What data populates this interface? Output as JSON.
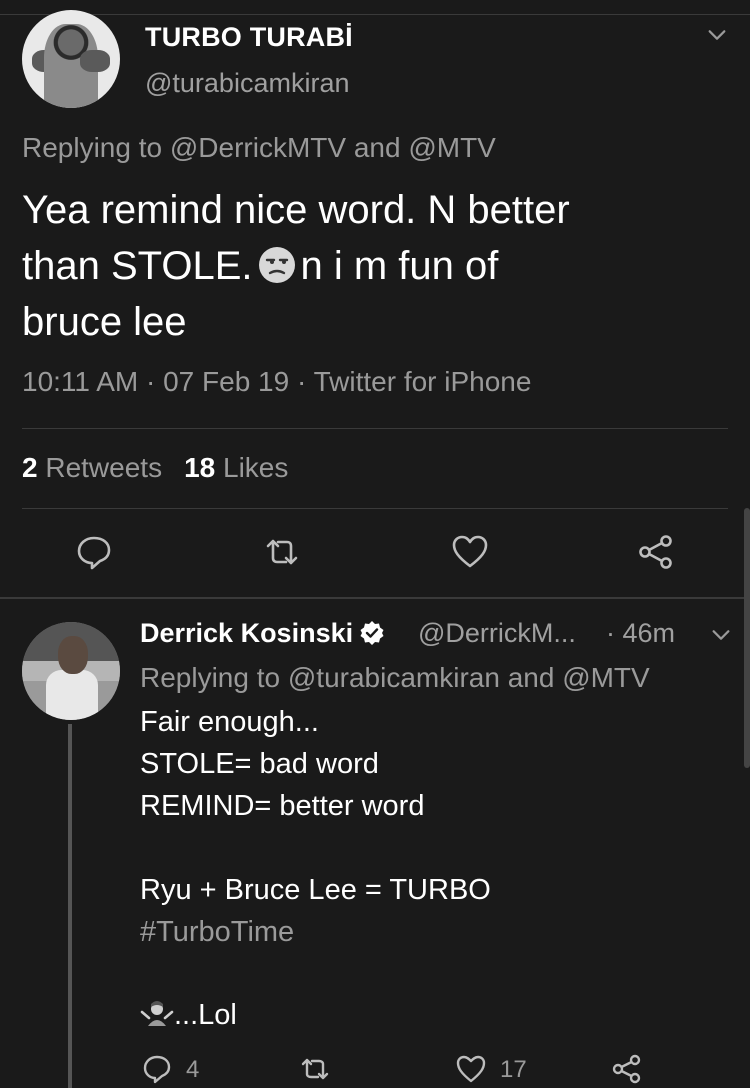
{
  "tweet": {
    "display_name": "TURBO TURABİ",
    "handle": "@turabicamkiran",
    "replying": "Replying to @DerrickMTV and @MTV",
    "text_line1": "Yea remind nice word. N better",
    "text_line2a": "than STOLE.",
    "text_line2b": "n i m fun of",
    "text_line3": "bruce lee",
    "meta": "10:11 AM · 07 Feb 19 · Twitter for iPhone",
    "retweets_count": "2",
    "retweets_label": "Retweets",
    "likes_count": "18",
    "likes_label": "Likes",
    "icons": [
      "reply-icon",
      "retweet-icon",
      "like-icon",
      "share-icon"
    ]
  },
  "reply": {
    "display_name": "Derrick Kosinski",
    "handle": "@DerrickM...",
    "time": "· 46m",
    "replying": "Replying to @turabicamkiran and @MTV",
    "line1": "Fair enough...",
    "line2": "STOLE= bad word",
    "line3": "REMIND= better word",
    "line4": "Ryu + Bruce Lee = TURBO",
    "hashtag": "#TurboTime",
    "line6": "...Lol",
    "reply_count": "4",
    "like_count": "17"
  }
}
